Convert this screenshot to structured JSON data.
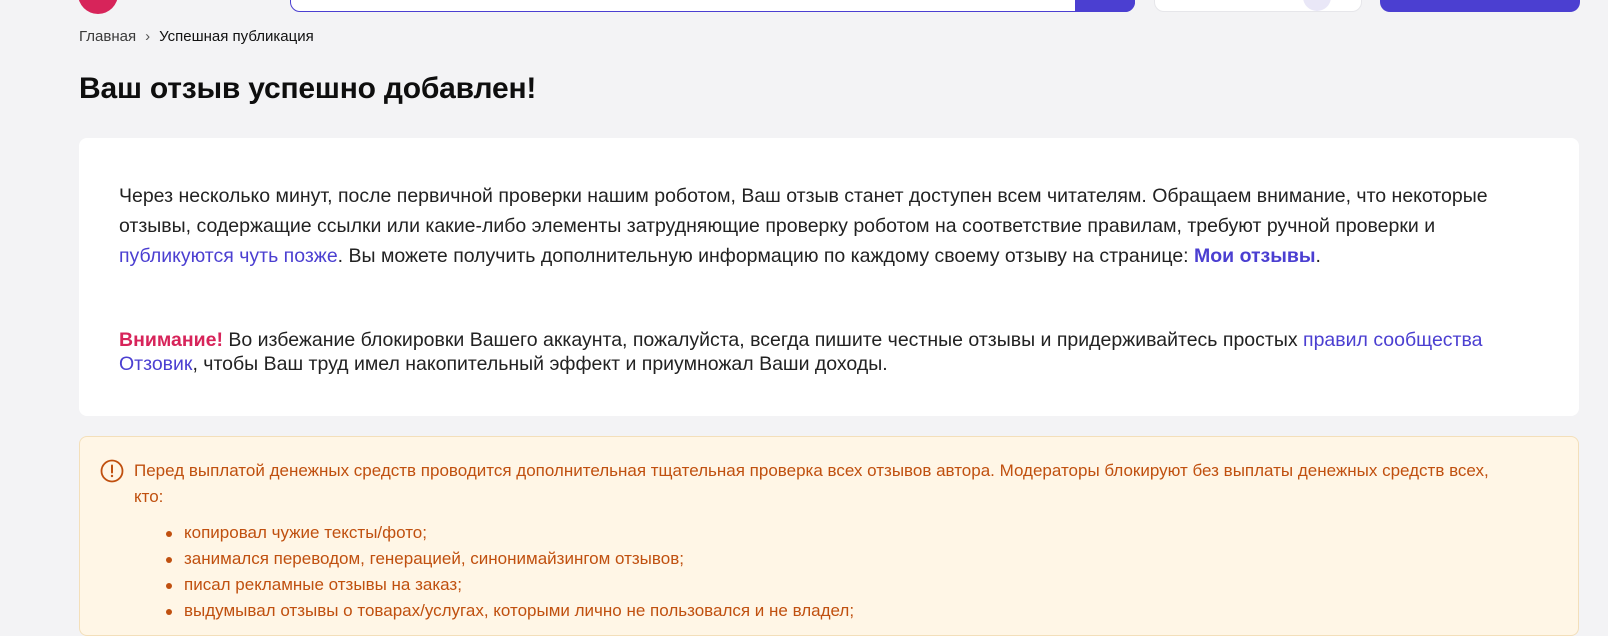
{
  "breadcrumb": {
    "home": "Главная",
    "separator": "›",
    "current": "Успешная публикация"
  },
  "page_title": "Ваш отзыв успешно добавлен!",
  "card": {
    "p1_text1": "Через несколько минут, после первичной проверки нашим роботом, Ваш отзыв станет доступен всем читателям. Обращаем внимание, что некоторые отзывы, содержащие ссылки или какие-либо элементы затрудняющие проверку роботом на соответствие правилам, требуют ручной проверки и ",
    "p1_link": "публикуются чуть позже",
    "p1_text2": ". Вы можете получить дополнительную информацию по каждому своему отзыву на странице: ",
    "p1_link2": "Мои отзывы",
    "p1_end": ".",
    "warning_label": "Внимание!",
    "p2_text1": " Во избежание блокировки Вашего аккаунта, пожалуйста, всегда пишите честные отзывы и придерживайтесь простых ",
    "p2_link": "правил сообщества Отзовик",
    "p2_text2": ", чтобы Ваш труд имел накопительный эффект и приумножал Ваши доходы."
  },
  "notice": {
    "icon": "exclamation-circle-icon",
    "text": "Перед выплатой денежных средств проводится дополнительная тщательная проверка всех отзывов автора. Модераторы блокируют без выплаты денежных средств всех, кто:",
    "items": [
      "копировал чужие тексты/фото;",
      "занимался переводом, генерацией, синонимайзингом отзывов;",
      "писал рекламные отзывы на заказ;",
      "выдумывал отзывы о товарах/услугах, которыми лично не пользовался и не владел;"
    ]
  },
  "colors": {
    "accent": "#4b3fd1",
    "brand_red": "#d7245a",
    "notice_text": "#c0500f",
    "notice_bg": "#fff6e6"
  }
}
